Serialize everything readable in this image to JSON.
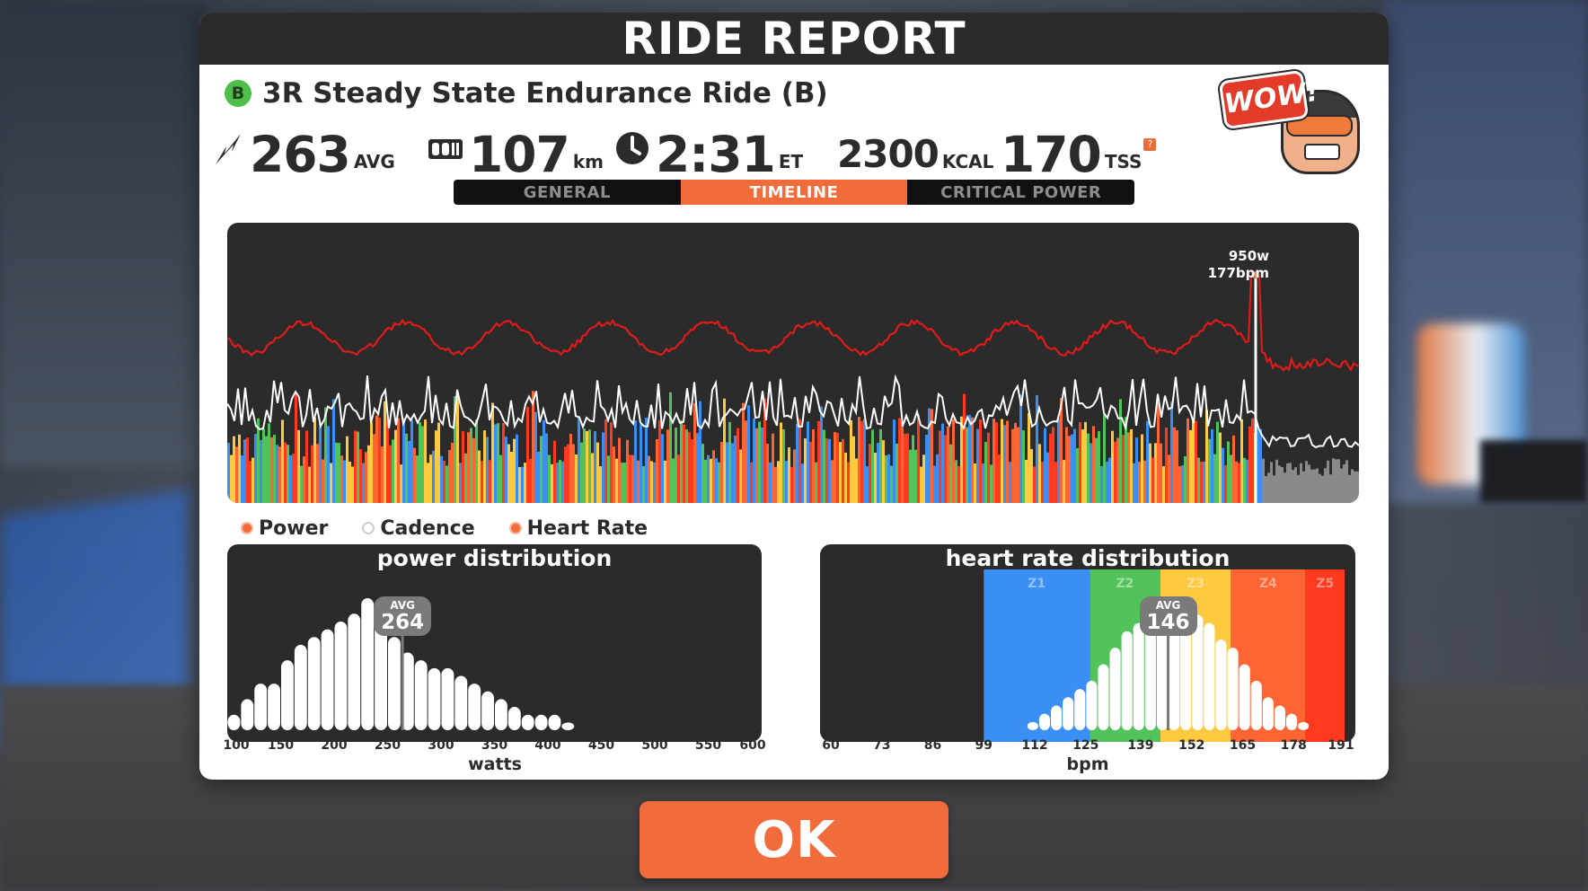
{
  "header": {
    "title": "RIDE REPORT"
  },
  "workout": {
    "category": "B",
    "name": "3R Steady State Endurance Ride (B)"
  },
  "stats": {
    "power": {
      "value": "263",
      "unit": "AVG",
      "icon": "lightning-icon"
    },
    "distance": {
      "value": "107",
      "unit": "km",
      "icon": "odometer-icon"
    },
    "time": {
      "value": "2:31",
      "unit": "ET",
      "icon": "clock-icon"
    },
    "calories": {
      "value": "2300",
      "unit": "KCAL"
    },
    "tss": {
      "value": "170",
      "unit": "TSS",
      "help": "?"
    }
  },
  "badge": {
    "text": "WOW!"
  },
  "tabs": [
    {
      "label": "GENERAL",
      "active": false
    },
    {
      "label": "TIMELINE",
      "active": true
    },
    {
      "label": "CRITICAL POWER",
      "active": false
    }
  ],
  "timeline": {
    "peak_power": "950w",
    "peak_hr": "177bpm"
  },
  "legend": [
    {
      "label": "Power",
      "on": true
    },
    {
      "label": "Cadence",
      "on": false
    },
    {
      "label": "Heart Rate",
      "on": true
    }
  ],
  "chart_data": [
    {
      "type": "bar",
      "title": "power distribution",
      "xlabel": "watts",
      "x_ticks": [
        "100",
        "150",
        "200",
        "250",
        "300",
        "350",
        "400",
        "450",
        "500",
        "550",
        "600"
      ],
      "xlim": [
        100,
        600
      ],
      "bin_width": 12.5,
      "values": [
        2,
        4,
        6,
        6,
        9,
        11,
        12,
        13,
        14,
        15,
        17,
        15,
        12,
        10,
        9,
        8,
        8,
        7,
        6,
        5,
        4,
        3,
        2,
        2,
        2,
        1,
        0,
        0,
        0,
        0
      ],
      "bin_start": 100,
      "avg_label": "AVG",
      "avg_value": "264"
    },
    {
      "type": "bar",
      "title": "heart rate distribution",
      "xlabel": "bpm",
      "x_ticks": [
        "60",
        "73",
        "86",
        "99",
        "112",
        "125",
        "139",
        "152",
        "165",
        "178",
        "191"
      ],
      "xlim": [
        60,
        191
      ],
      "zones": [
        {
          "name": "Z1",
          "from": 99,
          "to": 126,
          "color": "#3a8ff5"
        },
        {
          "name": "Z2",
          "from": 126,
          "to": 144,
          "color": "#52c35a"
        },
        {
          "name": "Z3",
          "from": 144,
          "to": 162,
          "color": "#fdc93f"
        },
        {
          "name": "Z4",
          "from": 162,
          "to": 181,
          "color": "#ff6433"
        },
        {
          "name": "Z5",
          "from": 181,
          "to": 191,
          "color": "#ff3a1e"
        }
      ],
      "hr_bins": [
        110,
        113,
        116,
        119,
        122,
        125,
        128,
        131,
        134,
        137,
        140,
        143,
        146,
        149,
        152,
        155,
        158,
        161,
        164,
        167,
        170,
        173,
        176,
        179
      ],
      "values": [
        1,
        2,
        3,
        4,
        5,
        6,
        8,
        10,
        12,
        13,
        14,
        15,
        16,
        15,
        14,
        13,
        11,
        10,
        8,
        6,
        4,
        3,
        2,
        1
      ],
      "avg_label": "AVG",
      "avg_value": "146"
    }
  ],
  "ok_button": {
    "label": "OK"
  }
}
